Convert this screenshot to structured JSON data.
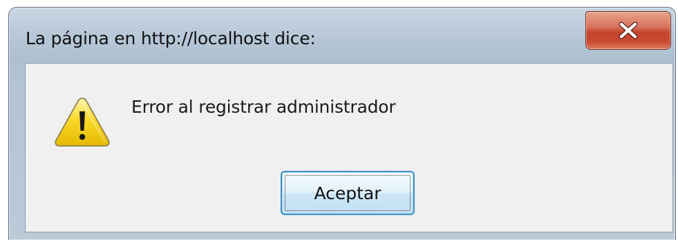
{
  "dialog": {
    "title": "La página en http://localhost dice:",
    "message": "Error al registrar administrador",
    "ok_label": "Aceptar",
    "close_icon": "close-icon",
    "message_icon": "warning-icon"
  },
  "colors": {
    "titlebar": "#b8c8d8",
    "close_button": "#c94a32",
    "content_background": "#f0f0f0",
    "ok_button_border": "#3c8fc7",
    "warning_yellow": "#f5d20f"
  }
}
